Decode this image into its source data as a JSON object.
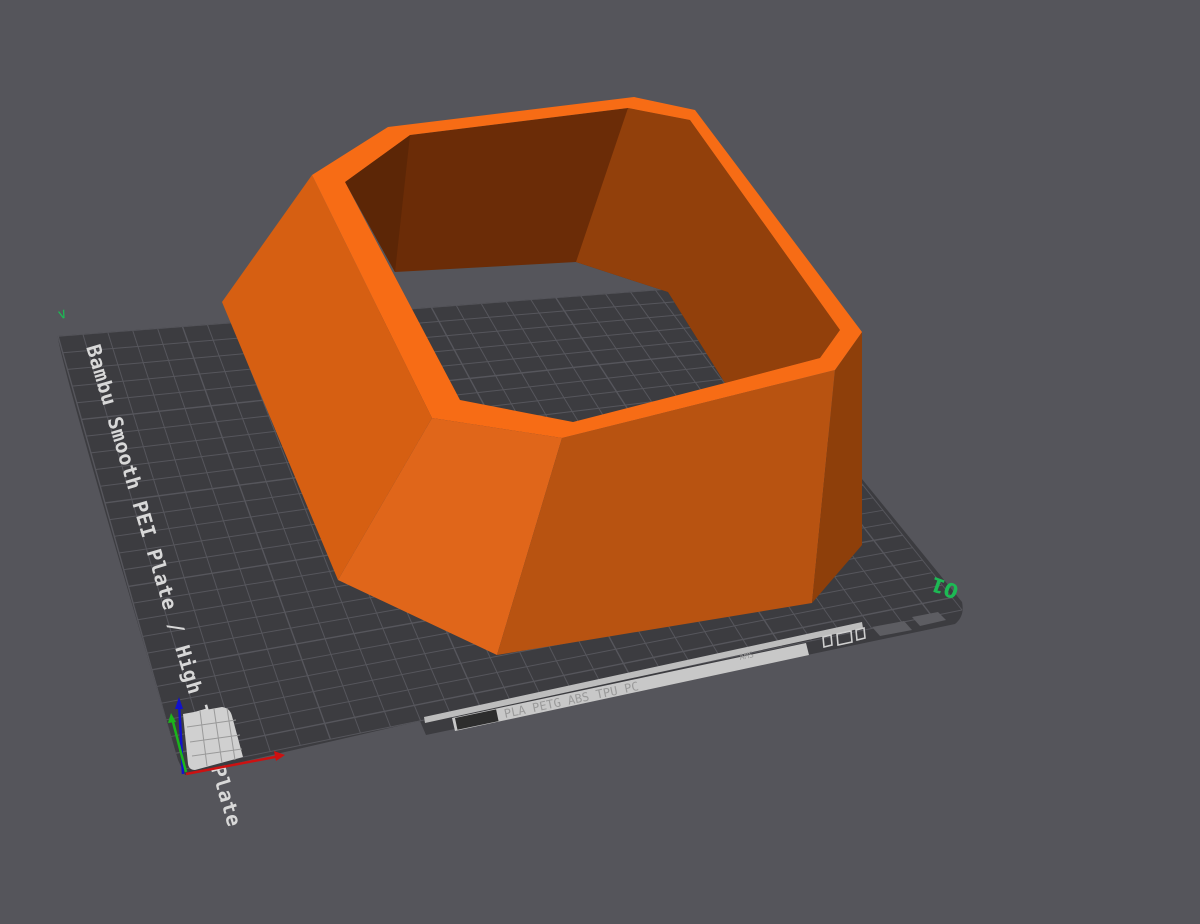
{
  "viewport": {
    "background": "#55555b"
  },
  "build_plate": {
    "name": "Bambu Smooth PEI Plate / High Temp Plate",
    "surface_color": "#3c3c40",
    "grid_color": "#56565c",
    "plate_number": "01",
    "corner_mark": "∨",
    "marker_color": "#1db954",
    "filament_strip": {
      "label": "PLA PETG ABS TPU PC",
      "small_label": "AMS"
    }
  },
  "model": {
    "colors": {
      "top_rim": "#f76c15",
      "front_face": "#b85311",
      "left_face": "#d65f12",
      "inner_wall": "#6b2c07"
    }
  },
  "axes": {
    "x_color": "#cc1111",
    "y_color": "#1bb51b",
    "z_color": "#1111cc"
  }
}
